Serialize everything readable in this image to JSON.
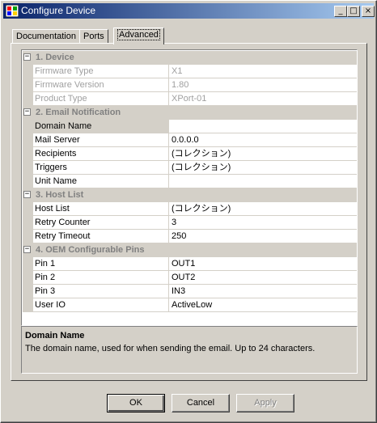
{
  "window": {
    "title": "Configure Device"
  },
  "titlebar_buttons": {
    "minimize": "_",
    "maximize": "□",
    "close": "×"
  },
  "tabs": [
    {
      "label": "Documentation",
      "active": false
    },
    {
      "label": "Ports",
      "active": false
    },
    {
      "label": "Advanced",
      "active": true
    }
  ],
  "grid": {
    "categories": [
      {
        "label": "1. Device",
        "toggle": "−",
        "props": [
          {
            "name": "Firmware Type",
            "value": "X1"
          },
          {
            "name": "Firmware Version",
            "value": "1.80"
          },
          {
            "name": "Product Type",
            "value": "XPort-01"
          }
        ]
      },
      {
        "label": "2. Email Notification",
        "toggle": "−",
        "props": [
          {
            "name": "Domain Name",
            "value": ""
          },
          {
            "name": "Mail Server",
            "value": "0.0.0.0"
          },
          {
            "name": "Recipients",
            "value": "(コレクション)"
          },
          {
            "name": "Triggers",
            "value": "(コレクション)"
          },
          {
            "name": "Unit Name",
            "value": ""
          }
        ]
      },
      {
        "label": "3. Host List",
        "toggle": "−",
        "props": [
          {
            "name": "Host List",
            "value": "(コレクション)"
          },
          {
            "name": "Retry Counter",
            "value": "3"
          },
          {
            "name": "Retry Timeout",
            "value": "250"
          }
        ]
      },
      {
        "label": "4. OEM Configurable Pins",
        "toggle": "−",
        "props": [
          {
            "name": "Pin 1",
            "value": "OUT1"
          },
          {
            "name": "Pin 2",
            "value": "OUT2"
          },
          {
            "name": "Pin 3",
            "value": "IN3"
          },
          {
            "name": "User IO",
            "value": "ActiveLow"
          }
        ]
      }
    ]
  },
  "description": {
    "title": "Domain Name",
    "text": "The domain name, used for when sending the email.  Up to 24 characters."
  },
  "buttons": {
    "ok": "OK",
    "cancel": "Cancel",
    "apply": "Apply"
  },
  "colors": {
    "titlebar_start": "#0a246a",
    "titlebar_end": "#a6caf0",
    "face": "#d4d0c8",
    "disabled_text": "#a0a0a0"
  }
}
